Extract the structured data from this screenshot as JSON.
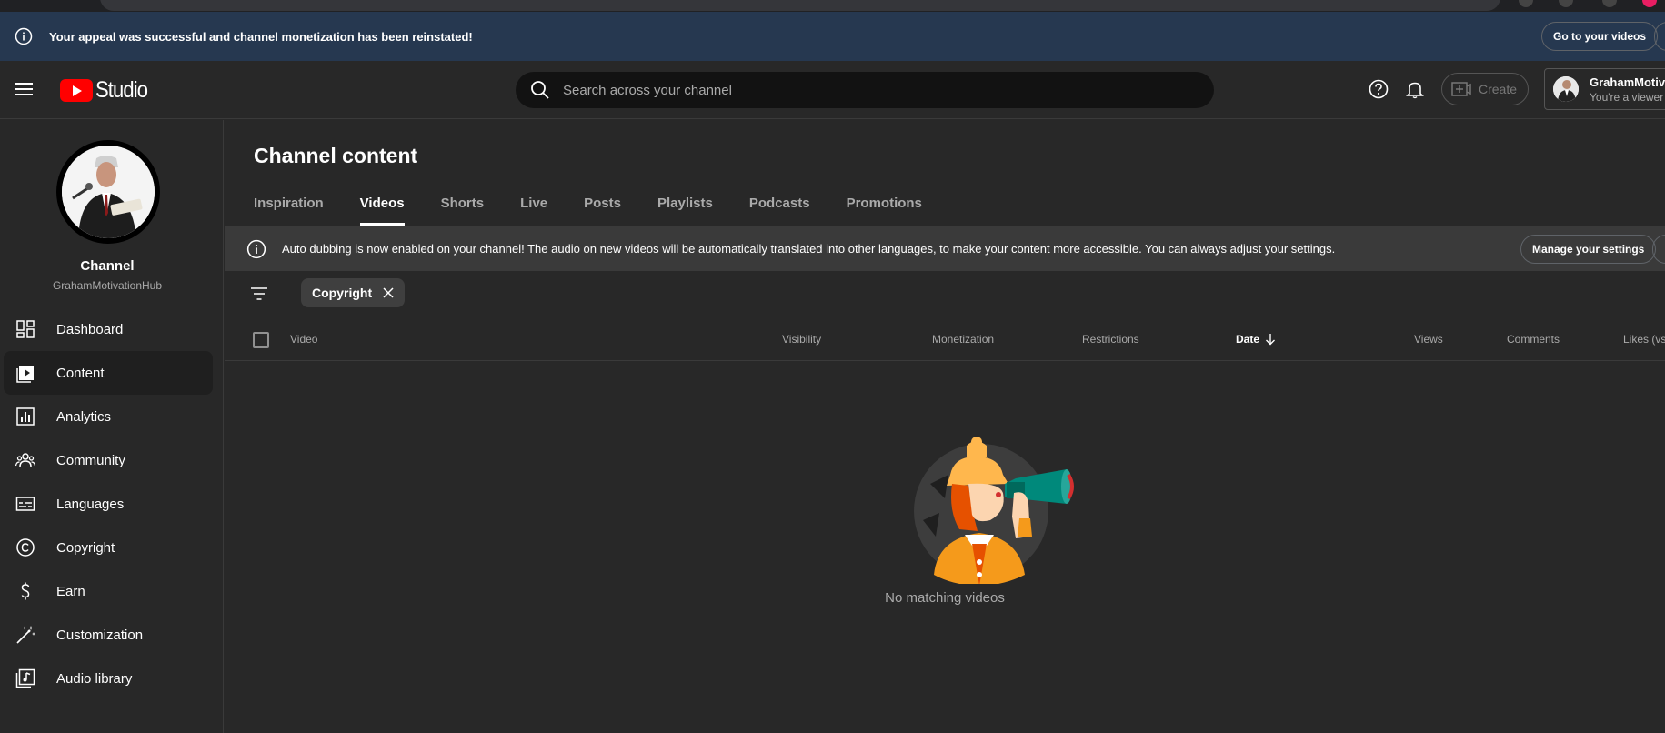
{
  "colors": {
    "banner_bg": "#263850",
    "page_bg": "#282828",
    "brand_red": "#ff0000",
    "illustration_orange": "#f57c00",
    "illustration_teal": "#00897b"
  },
  "appeal_banner": {
    "message": "Your appeal was successful and channel monetization has been reinstated!",
    "go_button": "Go to your videos"
  },
  "header": {
    "logo_text": "Studio",
    "search_placeholder": "Search across your channel",
    "create_label": "Create",
    "account_name": "GrahamMotivationHub",
    "account_role": "You're a viewer"
  },
  "sidebar": {
    "channel_title": "Channel",
    "channel_handle": "GrahamMotivationHub",
    "items": [
      {
        "label": "Dashboard",
        "icon": "dashboard-icon"
      },
      {
        "label": "Content",
        "icon": "content-icon"
      },
      {
        "label": "Analytics",
        "icon": "analytics-icon"
      },
      {
        "label": "Community",
        "icon": "community-icon"
      },
      {
        "label": "Languages",
        "icon": "languages-icon"
      },
      {
        "label": "Copyright",
        "icon": "copyright-icon"
      },
      {
        "label": "Earn",
        "icon": "earn-icon"
      },
      {
        "label": "Customization",
        "icon": "customization-icon"
      },
      {
        "label": "Audio library",
        "icon": "audio-library-icon"
      }
    ],
    "active_item": "Content"
  },
  "main": {
    "title": "Channel content",
    "tabs": [
      "Inspiration",
      "Videos",
      "Shorts",
      "Live",
      "Posts",
      "Playlists",
      "Podcasts",
      "Promotions"
    ],
    "active_tab": "Videos",
    "dubbing_banner": {
      "message": "Auto dubbing is now enabled on your channel! The audio on new videos will be automatically translated into other languages, to make your content more accessible. You can always adjust your settings.",
      "button": "Manage your settings"
    },
    "filter_chip": "Copyright",
    "columns": [
      "Video",
      "Visibility",
      "Monetization",
      "Restrictions",
      "Date",
      "Views",
      "Comments",
      "Likes (vs"
    ],
    "sorted_column": "Date",
    "empty_message": "No matching videos"
  }
}
